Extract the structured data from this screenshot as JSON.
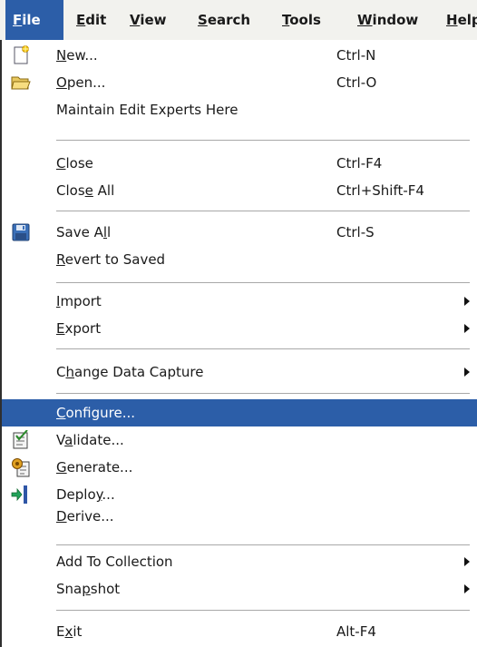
{
  "menubar": {
    "items": [
      {
        "pre": "",
        "mn": "F",
        "post": "ile"
      },
      {
        "pre": "",
        "mn": "E",
        "post": "dit"
      },
      {
        "pre": "",
        "mn": "V",
        "post": "iew"
      },
      {
        "pre": "",
        "mn": "S",
        "post": "earch"
      },
      {
        "pre": "",
        "mn": "T",
        "post": "ools"
      },
      {
        "pre": "",
        "mn": "W",
        "post": "indow"
      },
      {
        "pre": "",
        "mn": "H",
        "post": "elp"
      }
    ]
  },
  "file_menu": {
    "items": [
      {
        "pre": "",
        "mn": "N",
        "post": "ew...",
        "accel": "Ctrl-N"
      },
      {
        "pre": "",
        "mn": "O",
        "post": "pen...",
        "accel": "Ctrl-O"
      },
      {
        "pre": "Maintain Edit Experts Here",
        "mn": "",
        "post": "",
        "accel": ""
      },
      {
        "pre": "",
        "mn": "C",
        "post": "lose",
        "accel": "Ctrl-F4"
      },
      {
        "pre": "Clos",
        "mn": "e",
        "post": " All",
        "accel": "Ctrl+Shift-F4"
      },
      {
        "pre": "Save A",
        "mn": "l",
        "post": "l",
        "accel": "Ctrl-S"
      },
      {
        "pre": "",
        "mn": "R",
        "post": "evert to Saved",
        "accel": ""
      },
      {
        "pre": "",
        "mn": "I",
        "post": "mport",
        "accel": ""
      },
      {
        "pre": "",
        "mn": "E",
        "post": "xport",
        "accel": ""
      },
      {
        "pre": "C",
        "mn": "h",
        "post": "ange Data Capture",
        "accel": ""
      },
      {
        "pre": "",
        "mn": "C",
        "post": "onfigure...",
        "accel": ""
      },
      {
        "pre": "V",
        "mn": "a",
        "post": "lidate...",
        "accel": ""
      },
      {
        "pre": "",
        "mn": "G",
        "post": "enerate...",
        "accel": ""
      },
      {
        "pre": "Deplo",
        "mn": "y",
        "post": "...",
        "accel": ""
      },
      {
        "pre": "",
        "mn": "D",
        "post": "erive...",
        "accel": ""
      },
      {
        "pre": "Add To Collection",
        "mn": "",
        "post": "",
        "accel": ""
      },
      {
        "pre": "Sna",
        "mn": "p",
        "post": "shot",
        "accel": ""
      },
      {
        "pre": "E",
        "mn": "x",
        "post": "it",
        "accel": "Alt-F4"
      }
    ],
    "selected_item": "configure",
    "icons": [
      "new-file-icon",
      "open-folder-icon",
      "save-all-icon",
      "validate-icon",
      "generate-icon",
      "deploy-icon",
      "submenu-arrow-icon"
    ],
    "colors": {
      "highlight": "#2c5ea8",
      "highlight_text": "#ffffff"
    }
  }
}
